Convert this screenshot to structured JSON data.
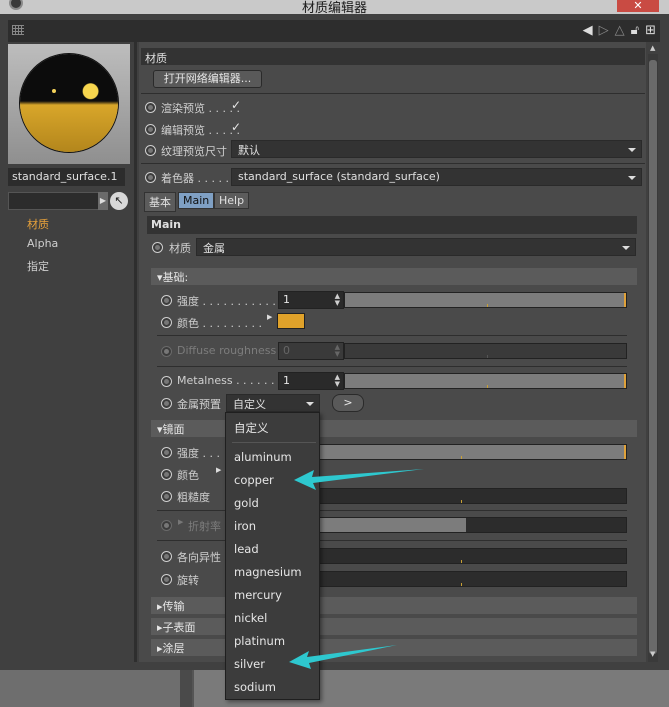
{
  "window": {
    "title": "材质编辑器",
    "close_label": "✕"
  },
  "toolbar": {
    "icons": [
      "back-arrow-icon",
      "forward-arrow-icon",
      "up-arrow-icon",
      "lock-icon",
      "new-window-icon"
    ]
  },
  "left": {
    "material_name": "standard_surface.1",
    "channels": [
      "材质",
      "Alpha",
      "指定"
    ],
    "active_channel": "材质"
  },
  "right": {
    "section_title": "材质",
    "open_node_editor": "打开网络编辑器...",
    "render_preview_label": "渲染预览 . . . . .",
    "edit_preview_label": "编辑预览 . . . . .",
    "texture_preview_label": "纹理预览尺寸",
    "texture_preview_value": "默认",
    "shader_label": "着色器 . . . . . .",
    "shader_value": "standard_surface (standard_surface)",
    "tabs": [
      "基本",
      "Main",
      "Help"
    ],
    "active_tab": "Main",
    "main_header": "Main",
    "material_label": "材质",
    "material_value": "金属",
    "base": {
      "group": "基础:",
      "strength_label": "强度 . . . . . . . . . . . .",
      "strength_value": "1",
      "strength_fill": 1.0,
      "color_label": "颜色 . . . . . . . . .",
      "color_hex": "#e0a22a",
      "diffuse_roughness_label": "Diffuse roughness",
      "diffuse_roughness_value": "0",
      "metalness_label": "Metalness . . . . . . .",
      "metalness_value": "1",
      "metalness_fill": 1.0,
      "metal_preset_label": "金属预置",
      "metal_preset_value": "自定义",
      "apply_label": ">"
    },
    "specular": {
      "group": "镜面",
      "strength_label": "强度 . . .",
      "color_label": "颜色",
      "roughness_label": "粗糙度",
      "ior_label": "折射率",
      "ior_fill": 0.48,
      "anisotropy_label": "各向异性",
      "rotation_label": "旋转"
    },
    "collapsed_groups": [
      "传输",
      "子表面",
      "涂层"
    ]
  },
  "preset_menu": {
    "selected": "自定义",
    "items": [
      "aluminum",
      "copper",
      "gold",
      "iron",
      "lead",
      "magnesium",
      "mercury",
      "nickel",
      "platinum",
      "silver",
      "sodium"
    ]
  }
}
